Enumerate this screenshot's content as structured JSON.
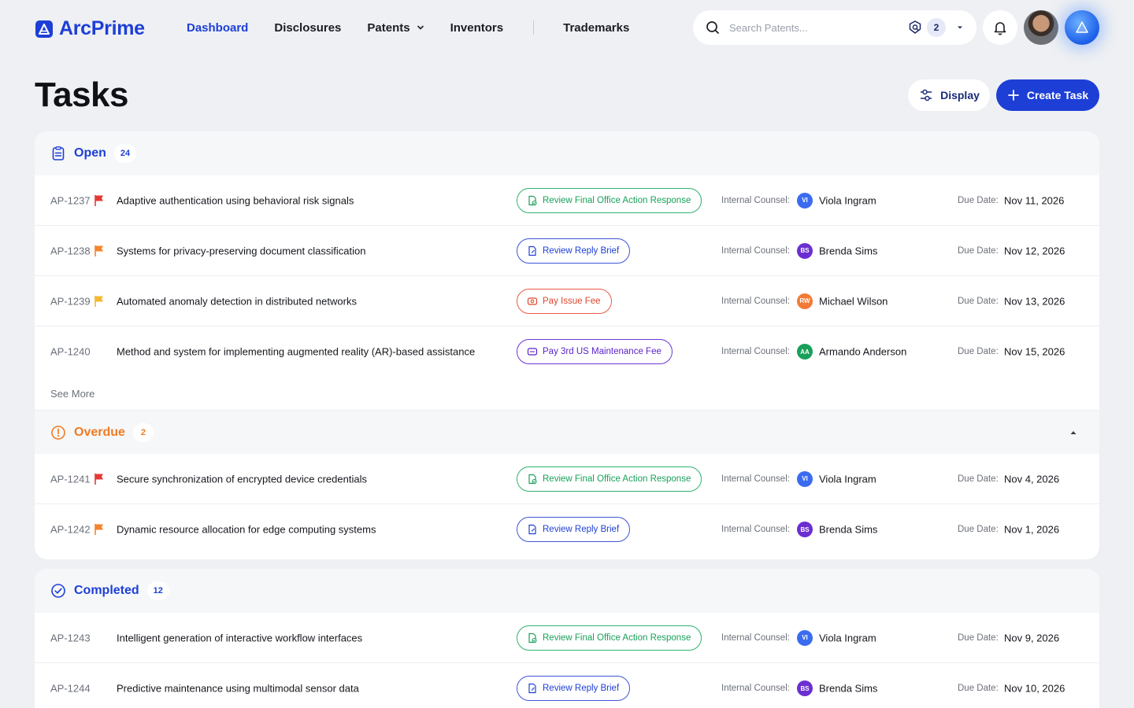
{
  "app": {
    "name": "ArcPrime"
  },
  "nav": {
    "items": [
      {
        "label": "Dashboard",
        "active": true
      },
      {
        "label": "Disclosures"
      },
      {
        "label": "Patents",
        "dropdown": true
      },
      {
        "label": "Inventors"
      },
      {
        "label": "Trademarks"
      }
    ]
  },
  "search": {
    "placeholder": "Search Patents...",
    "filter_count": "2"
  },
  "page": {
    "title": "Tasks"
  },
  "toolbar": {
    "display_label": "Display",
    "create_label": "Create Task"
  },
  "labels": {
    "internal_counsel": "Internal Counsel:",
    "due_date": "Due Date:",
    "see_more": "See More"
  },
  "colors": {
    "brand": "#1d3fd6",
    "overdue": "#f07b22",
    "flag_red": "#e53935",
    "flag_orange": "#f5842b",
    "flag_yellow": "#f5b82e"
  },
  "sections": {
    "open": {
      "title": "Open",
      "count": "24",
      "rows": [
        {
          "id": "AP-1237",
          "flag": "red",
          "title": "Adaptive authentication using behavioral risk signals",
          "action": "Review Final Office Action Response",
          "action_style": "green",
          "counsel_initials": "VI",
          "counsel_color": "#3b6cf0",
          "counsel": "Viola Ingram",
          "due": "Nov 11, 2026"
        },
        {
          "id": "AP-1238",
          "flag": "orange",
          "title": "Systems for privacy-preserving document classification",
          "action": "Review Reply Brief",
          "action_style": "blue",
          "counsel_initials": "BS",
          "counsel_color": "#6b2fd1",
          "counsel": "Brenda Sims",
          "due": "Nov 12, 2026"
        },
        {
          "id": "AP-1239",
          "flag": "yellow",
          "title": "Automated anomaly detection in distributed networks",
          "action": "Pay Issue Fee",
          "action_style": "red",
          "counsel_initials": "RW",
          "counsel_color": "#f27a35",
          "counsel": "Michael Wilson",
          "due": "Nov 13, 2026"
        },
        {
          "id": "AP-1240",
          "flag": "",
          "title": "Method and system for implementing augmented reality (AR)-based assistance",
          "action": "Pay 3rd US Maintenance Fee",
          "action_style": "purple",
          "counsel_initials": "AA",
          "counsel_color": "#18a05a",
          "counsel": "Armando Anderson",
          "due": "Nov 15, 2026"
        }
      ]
    },
    "overdue": {
      "title": "Overdue",
      "count": "2",
      "rows": [
        {
          "id": "AP-1241",
          "flag": "red",
          "title": "Secure synchronization of encrypted device credentials",
          "action": "Review Final Office Action Response",
          "action_style": "green",
          "counsel_initials": "VI",
          "counsel_color": "#3b6cf0",
          "counsel": "Viola Ingram",
          "due": "Nov 4, 2026"
        },
        {
          "id": "AP-1242",
          "flag": "orange",
          "title": "Dynamic resource allocation for edge computing systems",
          "action": "Review Reply Brief",
          "action_style": "blue",
          "counsel_initials": "BS",
          "counsel_color": "#6b2fd1",
          "counsel": "Brenda Sims",
          "due": "Nov 1, 2026"
        }
      ]
    },
    "completed": {
      "title": "Completed",
      "count": "12",
      "rows": [
        {
          "id": "AP-1243",
          "flag": "",
          "title": "Intelligent generation of interactive workflow interfaces",
          "action": "Review Final Office Action Response",
          "action_style": "green",
          "counsel_initials": "VI",
          "counsel_color": "#3b6cf0",
          "counsel": "Viola Ingram",
          "due": "Nov 9, 2026"
        },
        {
          "id": "AP-1244",
          "flag": "",
          "title": "Predictive maintenance using multimodal sensor data",
          "action": "Review Reply Brief",
          "action_style": "blue",
          "counsel_initials": "BS",
          "counsel_color": "#6b2fd1",
          "counsel": "Brenda Sims",
          "due": "Nov 10, 2026"
        }
      ]
    }
  }
}
